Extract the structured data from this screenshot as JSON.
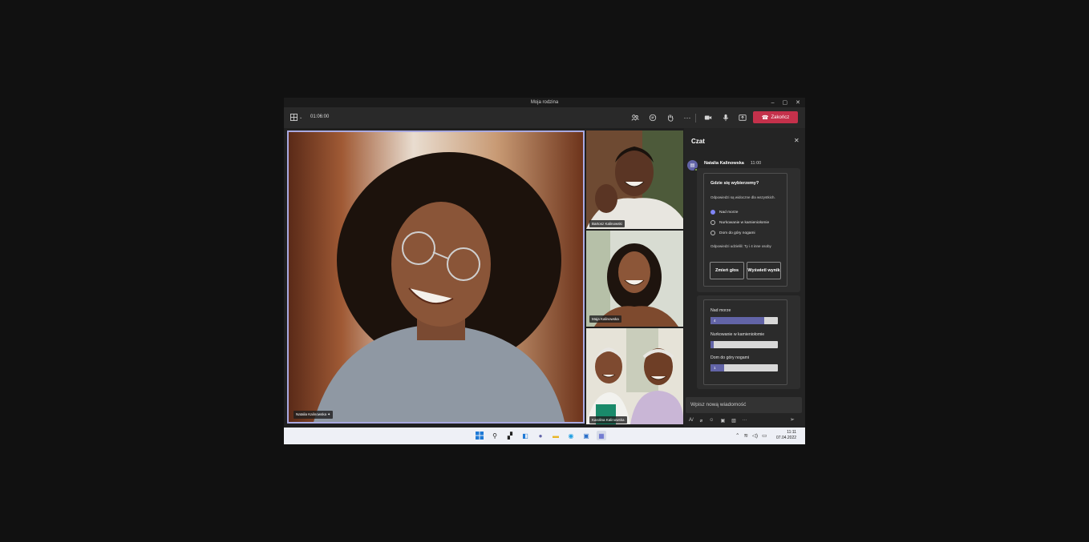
{
  "window": {
    "title": "Moja rodzina",
    "controls": [
      "–",
      "▢",
      "✕"
    ]
  },
  "toolbar": {
    "layout_icon": "grid-layout-icon",
    "timer": "01:06:00",
    "icons": [
      "participants-icon",
      "chat-icon",
      "raise-hand-icon",
      "more-icon",
      "camera-icon",
      "mic-icon",
      "share-icon"
    ],
    "end_call_label": "Zakończ",
    "end_call_color": "#c4314b"
  },
  "stage": {
    "main_participant": "Natalia Kalinowska",
    "thumbnails": [
      {
        "name": "Bartosz Kalinowski"
      },
      {
        "name": "Maja Kalinowska"
      },
      {
        "name": "Karolina Kalinowska"
      }
    ]
  },
  "chat": {
    "header": "Czat",
    "close_icon": "close-icon",
    "message": {
      "author": "Natalia Kalinowska",
      "time": "11:00",
      "poll": {
        "question": "Gdzie się wybierzemy?",
        "note": "Odpowiedzi są widoczne dla wszystkich.",
        "options": [
          {
            "label": "Nad morze",
            "selected": true
          },
          {
            "label": "Nurkowanie w kamieniołomie",
            "selected": false
          },
          {
            "label": "Dom do góry nogami",
            "selected": false
          }
        ],
        "responders": "Odpowiedzi udzielili: Ty i 4 inne osoby",
        "change_vote_label": "Zmień głos",
        "view_results_label": "Wyświetl wynik"
      }
    },
    "results": [
      {
        "label": "Nad morze",
        "count": "4",
        "fraction": 0.8
      },
      {
        "label": "Nurkowanie w kamieniołomie",
        "count": "",
        "fraction": 0
      },
      {
        "label": "Dom do góry nogami",
        "count": "1",
        "fraction": 0.2
      }
    ],
    "compose_placeholder": "Wpisz nową wiadomość",
    "accent": "#6264a7"
  },
  "taskbar": {
    "time": "11:11",
    "date": "07.04.2022"
  }
}
